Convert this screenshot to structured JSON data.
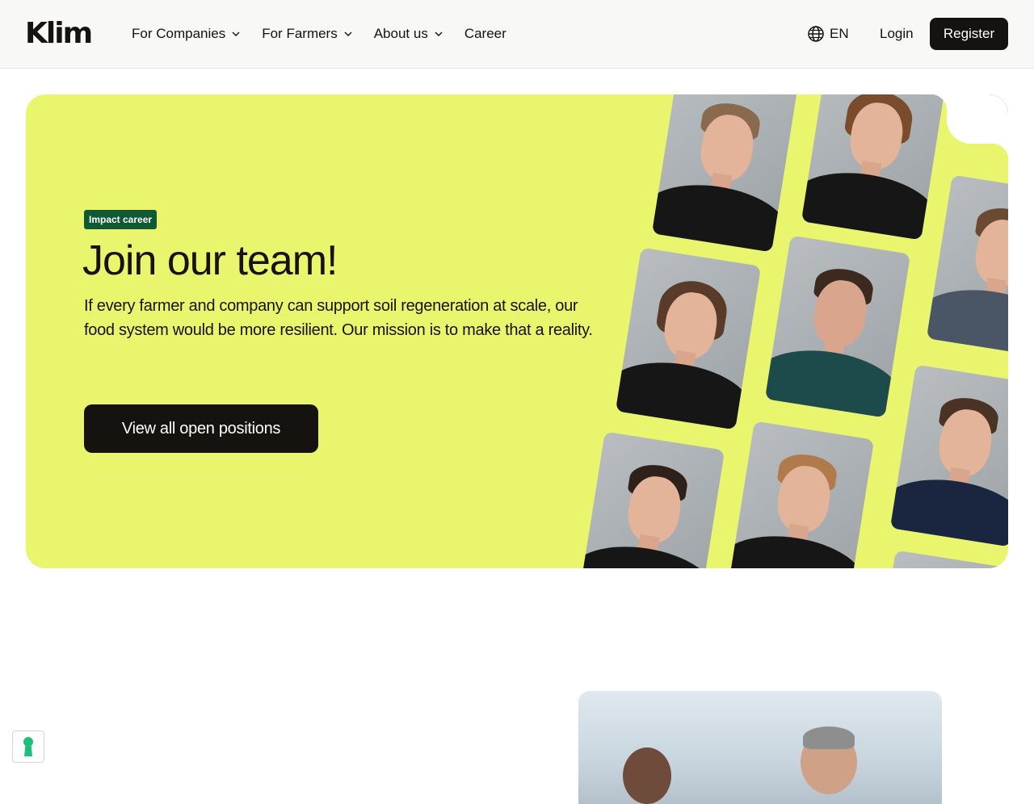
{
  "brand": {
    "logo_text": "Klim",
    "accent": "#e9f66d",
    "dark": "#16120f",
    "badge_green": "#0f5a35"
  },
  "nav": {
    "items": [
      {
        "label": "For Companies",
        "dropdown": true
      },
      {
        "label": "For Farmers",
        "dropdown": true
      },
      {
        "label": "About us",
        "dropdown": true
      },
      {
        "label": "Career",
        "dropdown": false
      }
    ]
  },
  "header": {
    "language": "EN",
    "login": "Login",
    "register": "Register"
  },
  "hero": {
    "badge": "Impact career",
    "title": "Join our team!",
    "description": "If every farmer and company can support soil regeneration at scale, our food system would be more resilient. Our mission is to make that a reality.",
    "cta": "View all open positions"
  },
  "icons": {
    "language": "globe-icon",
    "dropdown": "chevron-down-icon",
    "cookie": "keyhole-icon"
  }
}
